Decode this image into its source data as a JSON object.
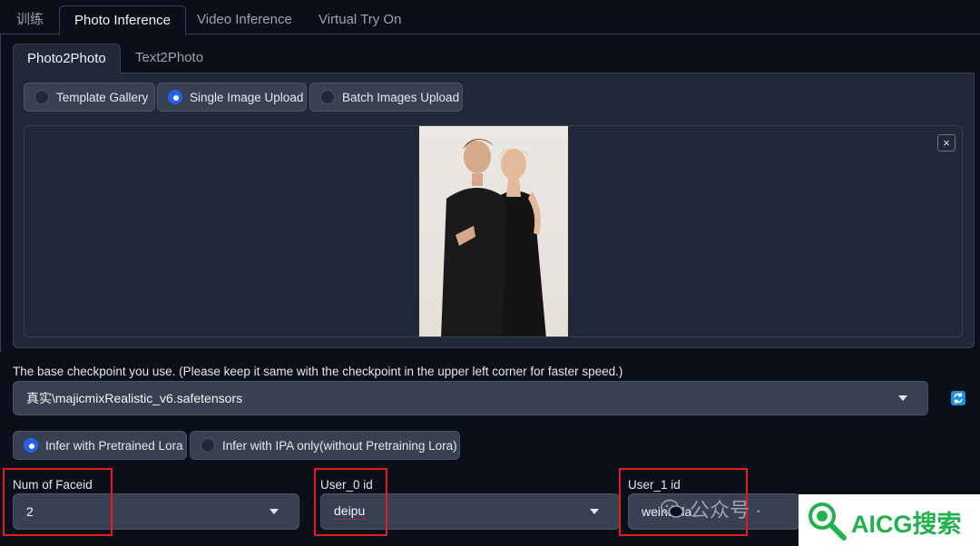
{
  "top_tabs": [
    "训练",
    "Photo Inference",
    "Video Inference",
    "Virtual Try On"
  ],
  "sub_tabs": [
    "Photo2Photo",
    "Text2Photo"
  ],
  "template_mode": {
    "options": [
      "Template Gallery",
      "Single Image Upload",
      "Batch Images Upload"
    ],
    "selected": "Single Image Upload"
  },
  "image_upload": {
    "close_label": "×"
  },
  "checkpoint": {
    "label": "The base checkpoint you use. (Please keep it same with the checkpoint in the upper left corner for faster speed.)",
    "value": "真实\\majicmixRealistic_v6.safetensors"
  },
  "lora_mode": {
    "options": [
      "Infer with Pretrained Lora",
      "Infer with IPA only(without Pretraining Lora)"
    ],
    "selected": "Infer with Pretrained Lora"
  },
  "num_faceid": {
    "label": "Num of Faceid",
    "value": "2"
  },
  "user0": {
    "label": "User_0 id",
    "value": "deipu"
  },
  "user1": {
    "label": "User_1 id",
    "value": "weinuola"
  },
  "watermark": {
    "wechat_text": "公众号 ·",
    "brand_text": "AICG搜索"
  },
  "colors": {
    "accent": "#2563eb",
    "annotation_red": "#e11d1d",
    "background": "#0b0f19",
    "panel": "#1f2937"
  }
}
